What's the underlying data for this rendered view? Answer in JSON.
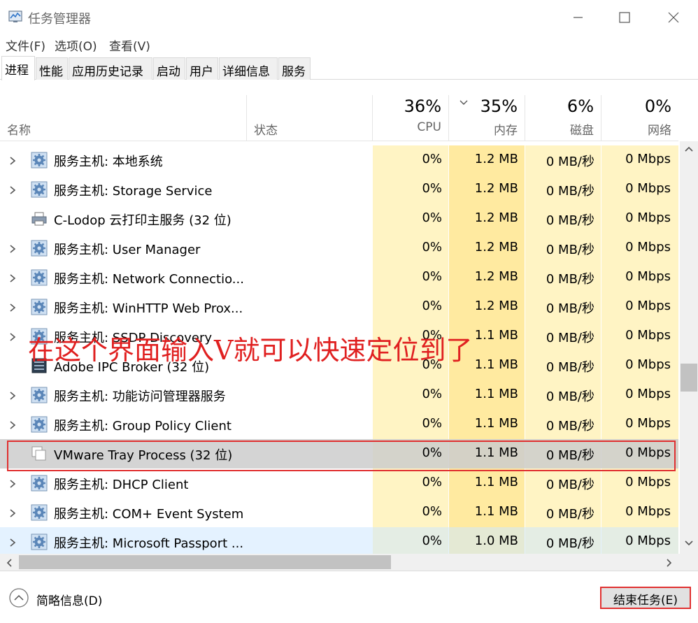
{
  "window": {
    "title": "任务管理器"
  },
  "menu": [
    "文件(F)",
    "选项(O)",
    "查看(V)"
  ],
  "tabs": [
    "进程",
    "性能",
    "应用历史记录",
    "启动",
    "用户",
    "详细信息",
    "服务"
  ],
  "columns": {
    "name": "名称",
    "status": "状态",
    "cpu": {
      "pct": "36%",
      "label": "CPU"
    },
    "memory": {
      "pct": "35%",
      "label": "内存"
    },
    "disk": {
      "pct": "6%",
      "label": "磁盘"
    },
    "network": {
      "pct": "0%",
      "label": "网络"
    }
  },
  "rows": [
    {
      "name": "服务主机: 本地系统",
      "cpu": "0%",
      "mem": "1.2 MB",
      "disk": "0 MB/秒",
      "net": "0 Mbps",
      "icon": "gear-icon",
      "expandable": true
    },
    {
      "name": "服务主机: Storage Service",
      "cpu": "0%",
      "mem": "1.2 MB",
      "disk": "0 MB/秒",
      "net": "0 Mbps",
      "icon": "gear-icon",
      "expandable": true
    },
    {
      "name": "C-Lodop 云打印主服务 (32 位)",
      "cpu": "0%",
      "mem": "1.2 MB",
      "disk": "0 MB/秒",
      "net": "0 Mbps",
      "icon": "printer-icon",
      "expandable": false
    },
    {
      "name": "服务主机: User Manager",
      "cpu": "0%",
      "mem": "1.2 MB",
      "disk": "0 MB/秒",
      "net": "0 Mbps",
      "icon": "gear-icon",
      "expandable": true
    },
    {
      "name": "服务主机: Network Connectio...",
      "cpu": "0%",
      "mem": "1.2 MB",
      "disk": "0 MB/秒",
      "net": "0 Mbps",
      "icon": "gear-icon",
      "expandable": true
    },
    {
      "name": "服务主机: WinHTTP Web Prox...",
      "cpu": "0%",
      "mem": "1.2 MB",
      "disk": "0 MB/秒",
      "net": "0 Mbps",
      "icon": "gear-icon",
      "expandable": true
    },
    {
      "name": "服务主机: SSDP Discovery",
      "cpu": "0%",
      "mem": "1.1 MB",
      "disk": "0 MB/秒",
      "net": "0 Mbps",
      "icon": "gear-icon",
      "expandable": true
    },
    {
      "name": "Adobe IPC Broker (32 位)",
      "cpu": "0%",
      "mem": "1.1 MB",
      "disk": "0 MB/秒",
      "net": "0 Mbps",
      "icon": "app-window-icon",
      "expandable": false
    },
    {
      "name": "服务主机: 功能访问管理器服务",
      "cpu": "0%",
      "mem": "1.1 MB",
      "disk": "0 MB/秒",
      "net": "0 Mbps",
      "icon": "gear-icon",
      "expandable": true
    },
    {
      "name": "服务主机: Group Policy Client",
      "cpu": "0%",
      "mem": "1.1 MB",
      "disk": "0 MB/秒",
      "net": "0 Mbps",
      "icon": "gear-icon",
      "expandable": true
    },
    {
      "name": "VMware Tray Process (32 位)",
      "cpu": "0%",
      "mem": "1.1 MB",
      "disk": "0 MB/秒",
      "net": "0 Mbps",
      "icon": "blank-window-icon",
      "expandable": false,
      "selected": true
    },
    {
      "name": "服务主机: DHCP Client",
      "cpu": "0%",
      "mem": "1.1 MB",
      "disk": "0 MB/秒",
      "net": "0 Mbps",
      "icon": "gear-icon",
      "expandable": true
    },
    {
      "name": "服务主机: COM+ Event System",
      "cpu": "0%",
      "mem": "1.1 MB",
      "disk": "0 MB/秒",
      "net": "0 Mbps",
      "icon": "gear-icon",
      "expandable": true
    },
    {
      "name": "服务主机: Microsoft Passport ...",
      "cpu": "0%",
      "mem": "1.0 MB",
      "disk": "0 MB/秒",
      "net": "0 Mbps",
      "icon": "gear-icon",
      "expandable": true,
      "hover": true
    }
  ],
  "annotation": "在这个界面输入V就可以快速定位到了",
  "footer": {
    "fewer_details": "简略信息(D)",
    "end_task": "结束任务(E)"
  },
  "colors": {
    "heat_light": "#fff4c4",
    "heat_mem": "#ffeaa0",
    "highlight": "#e03030",
    "selected_row": "#cccccc"
  }
}
